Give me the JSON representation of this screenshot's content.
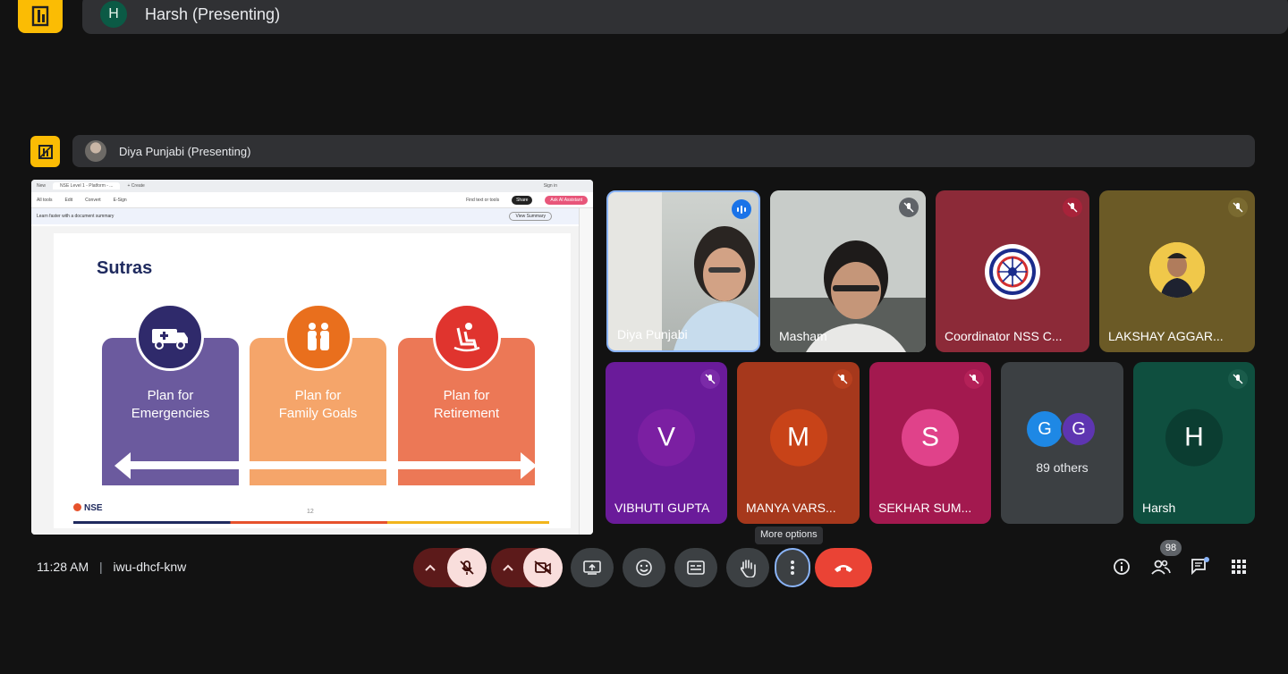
{
  "top_presenter": {
    "initial": "H",
    "label": "Harsh (Presenting)"
  },
  "second_presenter": {
    "label": "Diya Punjabi (Presenting)"
  },
  "shared_screen": {
    "tabs": [
      "New",
      "NSE Level 1 - Platform - ...",
      "+ Create"
    ],
    "sign_in": "Sign in",
    "menu": [
      "All tools",
      "Edit",
      "Convert",
      "E-Sign"
    ],
    "find_text": "Find text or tools",
    "share": "Share",
    "ask_ai": "Ask AI Assistant",
    "notice": "Learn faster with a document summary",
    "view_summary": "View Summary",
    "slide": {
      "title": "Sutras",
      "cards": [
        {
          "line1": "Plan for",
          "line2": "Emergencies",
          "color": "#6b5a9e",
          "circle": "#2f2a6b",
          "icon": "ambulance-icon"
        },
        {
          "line1": "Plan for",
          "line2": "Family Goals",
          "color": "#f5a56a",
          "circle": "#e96f1d",
          "icon": "family-icon"
        },
        {
          "line1": "Plan for",
          "line2": "Retirement",
          "color": "#ec7856",
          "circle": "#e0342e",
          "icon": "rocking-chair-icon"
        }
      ],
      "brand": "NSE",
      "page_number": "12"
    }
  },
  "participants_row1": [
    {
      "name": "Diya Punjabi",
      "type": "video",
      "speaking": true
    },
    {
      "name": "Masham",
      "type": "video",
      "muted": true
    },
    {
      "name": "Coordinator NSS C...",
      "type": "logo",
      "muted": true,
      "bg": "#8c2a38"
    },
    {
      "name": "LAKSHAY AGGAR...",
      "type": "photo",
      "muted": true,
      "bg": "#6b5a26"
    }
  ],
  "participants_row2": [
    {
      "name": "VIBHUTI GUPTA",
      "initial": "V",
      "bg": "#6a1b9a",
      "avatar": "#7b1fa2"
    },
    {
      "name": "MANYA VARS...",
      "initial": "M",
      "bg": "#a6381c",
      "avatar": "#c84318"
    },
    {
      "name": "SEKHAR SUM...",
      "initial": "S",
      "bg": "#a3194f",
      "avatar": "#e0428a"
    },
    {
      "name": "89 others",
      "initials": [
        "G",
        "G"
      ]
    },
    {
      "name": "Harsh",
      "initial": "H",
      "bg": "#0f4f3f",
      "avatar": "#0b3d31"
    }
  ],
  "bottom_bar": {
    "time": "11:28 AM",
    "separator": "|",
    "meeting_code": "iwu-dhcf-knw",
    "tooltip": "More options",
    "people_count": "98"
  },
  "colors": {
    "accent_yellow": "#fbbc04",
    "end_call": "#ea4335",
    "muted_red": "#f9dedc"
  }
}
